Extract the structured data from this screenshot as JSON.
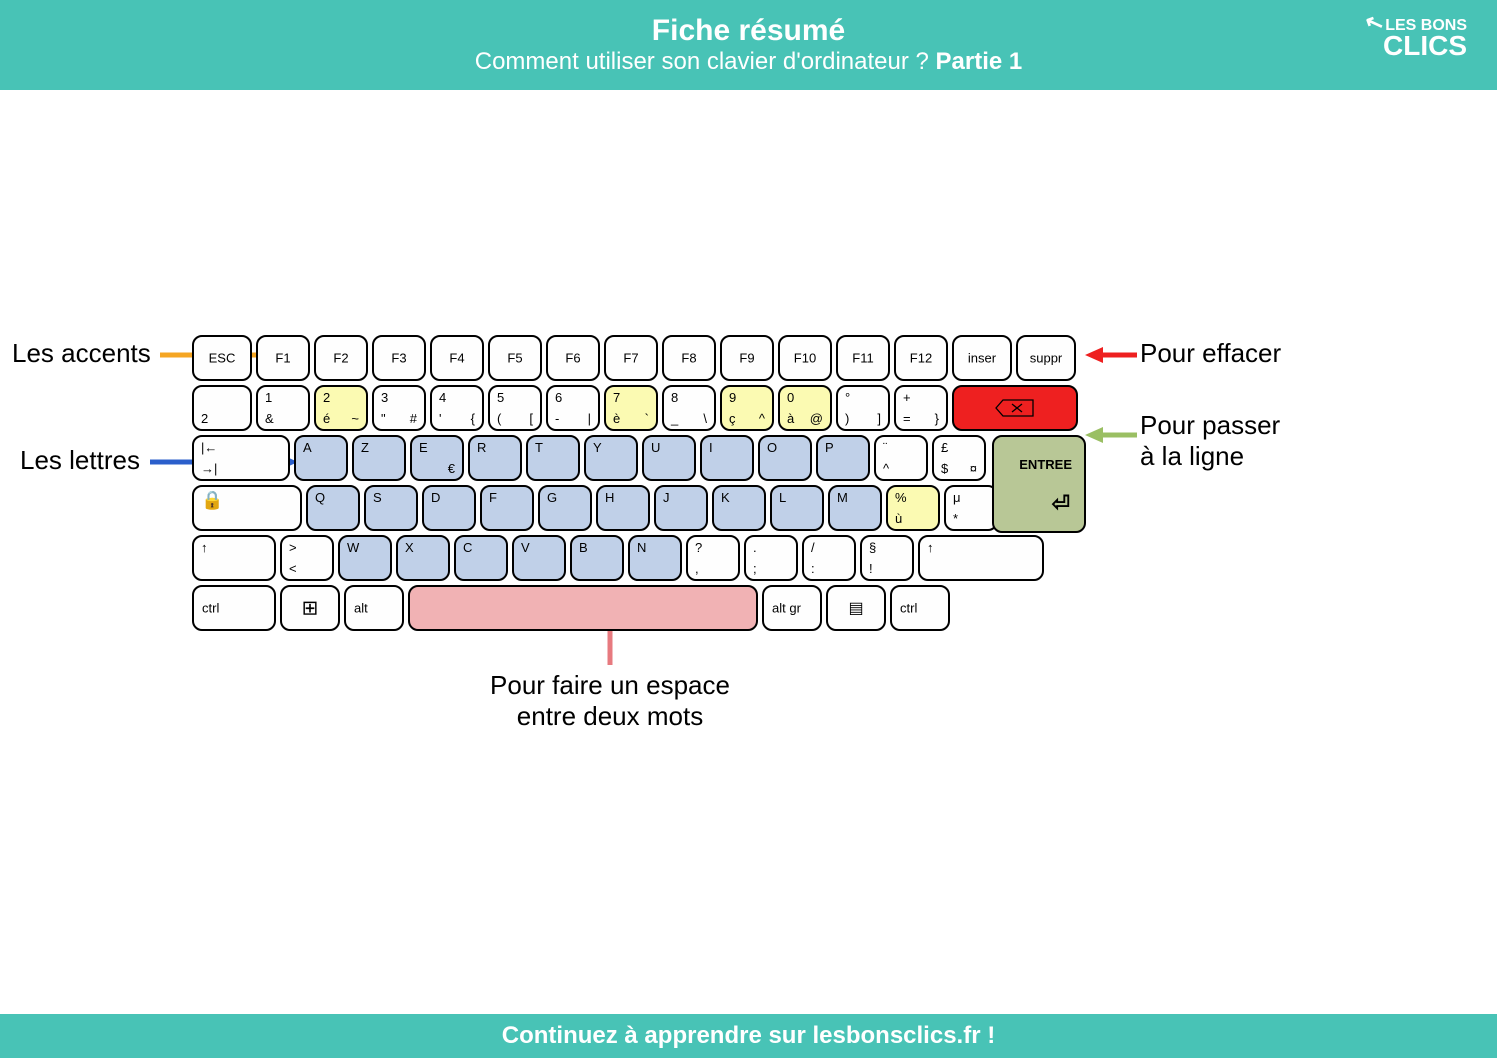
{
  "header": {
    "title": "Fiche résumé",
    "subtitle_plain": "Comment utiliser son clavier d'ordinateur ? ",
    "subtitle_bold": "Partie 1",
    "logo_top": "LES",
    "logo_main": "BONS",
    "logo_bottom": "CLICS"
  },
  "footer": "Continuez à apprendre sur lesbonsclics.fr !",
  "labels": {
    "accents": "Les accents",
    "letters": "Les lettres",
    "erase": "Pour effacer",
    "newline1": "Pour passer",
    "newline2": "à la ligne",
    "space1": "Pour faire un espace",
    "space2": "entre deux mots"
  },
  "colors": {
    "accents": "#f5a623",
    "letters": "#2b5fcb",
    "erase": "#ee2020",
    "newline": "#9abf63",
    "space": "#e77a7f",
    "teal": "#48c3b6"
  },
  "rows": {
    "r0": [
      {
        "c": "ESC",
        "w": "w1b"
      },
      {
        "c": "F1",
        "w": "w1"
      },
      {
        "c": "F2",
        "w": "w1"
      },
      {
        "c": "F3",
        "w": "w1"
      },
      {
        "c": "F4",
        "w": "w1"
      },
      {
        "c": "F5",
        "w": "w1"
      },
      {
        "c": "F6",
        "w": "w1"
      },
      {
        "c": "F7",
        "w": "w1"
      },
      {
        "c": "F8",
        "w": "w1"
      },
      {
        "c": "F9",
        "w": "w1"
      },
      {
        "c": "F10",
        "w": "w1"
      },
      {
        "c": "F11",
        "w": "w1"
      },
      {
        "c": "F12",
        "w": "w1"
      },
      {
        "c": "inser",
        "w": "w1b"
      },
      {
        "c": "suppr",
        "w": "w1b"
      }
    ],
    "r1": [
      {
        "bl": "2",
        "w": "w1b"
      },
      {
        "tl": "1",
        "bl": "&",
        "w": "w1"
      },
      {
        "tl": "2",
        "bl": "é",
        "br": "~",
        "w": "w1",
        "cl": "yellow"
      },
      {
        "tl": "3",
        "bl": "\"",
        "br": "#",
        "w": "w1"
      },
      {
        "tl": "4",
        "bl": "'",
        "br": "{",
        "w": "w1"
      },
      {
        "tl": "5",
        "bl": "(",
        "br": "[",
        "w": "w1"
      },
      {
        "tl": "6",
        "bl": "-",
        "br": "|",
        "w": "w1"
      },
      {
        "tl": "7",
        "bl": "è",
        "br": "`",
        "w": "w1",
        "cl": "yellow"
      },
      {
        "tl": "8",
        "bl": "_",
        "br": "\\",
        "w": "w1"
      },
      {
        "tl": "9",
        "bl": "ç",
        "br": "^",
        "w": "w1",
        "cl": "yellow"
      },
      {
        "tl": "0",
        "bl": "à",
        "br": "@",
        "w": "w1",
        "cl": "yellow"
      },
      {
        "tl": "°",
        "bl": ")",
        "br": "]",
        "w": "w1"
      },
      {
        "tl": "+",
        "bl": "=",
        "br": "}",
        "w": "w1"
      },
      {
        "w": "w4",
        "cl": "red",
        "name": "backspace-key"
      }
    ],
    "r2": [
      {
        "tl": "|←",
        "bl": "→|",
        "w": "w2b"
      },
      {
        "tl": "A",
        "w": "w1",
        "cl": "blue"
      },
      {
        "tl": "Z",
        "w": "w1",
        "cl": "blue"
      },
      {
        "tl": "E",
        "br": "€",
        "w": "w1",
        "cl": "blue"
      },
      {
        "tl": "R",
        "w": "w1",
        "cl": "blue"
      },
      {
        "tl": "T",
        "w": "w1",
        "cl": "blue"
      },
      {
        "tl": "Y",
        "w": "w1",
        "cl": "blue"
      },
      {
        "tl": "U",
        "w": "w1",
        "cl": "blue"
      },
      {
        "tl": "I",
        "w": "w1",
        "cl": "blue"
      },
      {
        "tl": "O",
        "w": "w1",
        "cl": "blue"
      },
      {
        "tl": "P",
        "w": "w1",
        "cl": "blue"
      },
      {
        "tl": "¨",
        "bl": "^",
        "w": "w1"
      },
      {
        "tl": "£",
        "bl": "$",
        "br": "¤",
        "w": "w1"
      }
    ],
    "r3": [
      {
        "w": "w3",
        "name": "capslock-key"
      },
      {
        "tl": "Q",
        "w": "w1",
        "cl": "blue"
      },
      {
        "tl": "S",
        "w": "w1",
        "cl": "blue"
      },
      {
        "tl": "D",
        "w": "w1",
        "cl": "blue"
      },
      {
        "tl": "F",
        "w": "w1",
        "cl": "blue"
      },
      {
        "tl": "G",
        "w": "w1",
        "cl": "blue"
      },
      {
        "tl": "H",
        "w": "w1",
        "cl": "blue"
      },
      {
        "tl": "J",
        "w": "w1",
        "cl": "blue"
      },
      {
        "tl": "K",
        "w": "w1",
        "cl": "blue"
      },
      {
        "tl": "L",
        "w": "w1",
        "cl": "blue"
      },
      {
        "tl": "M",
        "w": "w1",
        "cl": "blue"
      },
      {
        "tl": "%",
        "bl": "ù",
        "w": "w1",
        "cl": "yellow"
      },
      {
        "tl": "μ",
        "bl": "*",
        "w": "w1"
      }
    ],
    "r4": [
      {
        "tl": "↑",
        "w": "w2"
      },
      {
        "tl": ">",
        "bl": "<",
        "w": "w1"
      },
      {
        "tl": "W",
        "w": "w1",
        "cl": "blue"
      },
      {
        "tl": "X",
        "w": "w1",
        "cl": "blue"
      },
      {
        "tl": "C",
        "w": "w1",
        "cl": "blue"
      },
      {
        "tl": "V",
        "w": "w1",
        "cl": "blue"
      },
      {
        "tl": "B",
        "w": "w1",
        "cl": "blue"
      },
      {
        "tl": "N",
        "w": "w1",
        "cl": "blue"
      },
      {
        "tl": "?",
        "bl": ",",
        "w": "w1"
      },
      {
        "tl": ".",
        "bl": ";",
        "w": "w1"
      },
      {
        "tl": "/",
        "bl": ":",
        "w": "w1"
      },
      {
        "tl": "§",
        "bl": "!",
        "w": "w1"
      },
      {
        "tl": "↑",
        "w": "w4"
      }
    ],
    "r5": [
      {
        "lc": "ctrl",
        "w": "w2"
      },
      {
        "w": "w1b",
        "name": "windows-key"
      },
      {
        "lc": "alt",
        "w": "w1b"
      },
      {
        "w": "space",
        "cl": "pink",
        "name": "space-key"
      },
      {
        "lc": "alt gr",
        "w": "w1b"
      },
      {
        "w": "w1b",
        "name": "menu-key"
      },
      {
        "lc": "ctrl",
        "w": "w1b"
      }
    ],
    "enter": "ENTREE"
  }
}
